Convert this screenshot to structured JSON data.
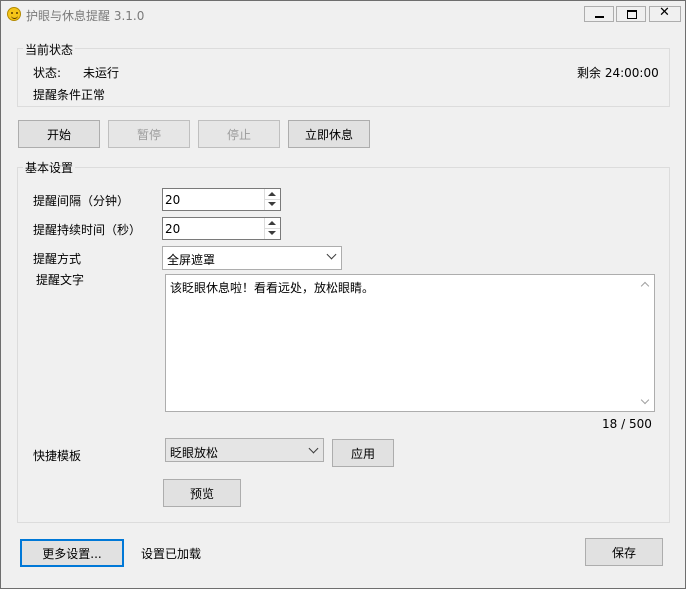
{
  "window": {
    "title": "护眼与休息提醒 3.1.0",
    "app_icon": "smiley-icon",
    "close_glyph": "✕"
  },
  "status_group": {
    "title": "当前状态",
    "status_label": "状态:",
    "status_value": "未运行",
    "remaining": "剩余 24:00:00",
    "condition": "提醒条件正常"
  },
  "controls": {
    "start": "开始",
    "pause": "暂停",
    "stop": "停止",
    "rest_now": "立即休息"
  },
  "settings": {
    "title": "基本设置",
    "interval_label": "提醒间隔（分钟）",
    "interval_value": "20",
    "duration_label": "提醒持续时间（秒）",
    "duration_value": "20",
    "method_label": "提醒方式",
    "method_value": "全屏遮罩",
    "text_label": "提醒文字",
    "text_value": "该眨眼休息啦！看看远处，放松眼睛。",
    "char_count": "18 / 500",
    "template_label": "快捷模板",
    "template_value": "眨眼放松",
    "apply": "应用",
    "preview": "预览"
  },
  "footer": {
    "more_settings": "更多设置...",
    "status": "设置已加载",
    "save": "保存"
  }
}
